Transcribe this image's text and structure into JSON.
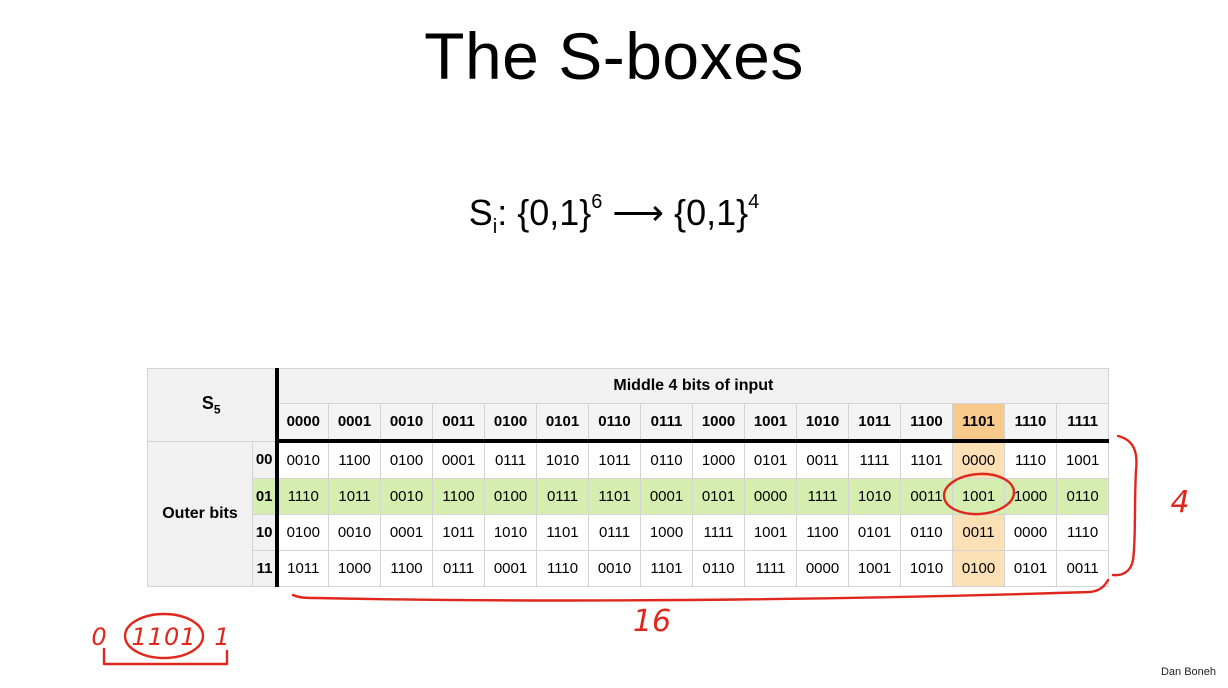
{
  "slide": {
    "title": "The S-boxes",
    "mapping": {
      "prefix": "S",
      "subscript": "i",
      "domain": ": {0,1}",
      "domain_exp": "6",
      "arrow": " ⟶ ",
      "codomain": "{0,1}",
      "codomain_exp": "4"
    },
    "credit": "Dan Boneh"
  },
  "table": {
    "name": "S",
    "name_sub": "5",
    "middle_header": "Middle 4 bits of input",
    "outer_header": "Outer bits",
    "columns": [
      "0000",
      "0001",
      "0010",
      "0011",
      "0100",
      "0101",
      "0110",
      "0111",
      "1000",
      "1001",
      "1010",
      "1011",
      "1100",
      "1101",
      "1110",
      "1111"
    ],
    "highlight_column": 13,
    "highlight_row": 1,
    "rows": [
      {
        "label": "00",
        "cells": [
          "0010",
          "1100",
          "0100",
          "0001",
          "0111",
          "1010",
          "1011",
          "0110",
          "1000",
          "0101",
          "0011",
          "1111",
          "1101",
          "0000",
          "1110",
          "1001"
        ]
      },
      {
        "label": "01",
        "cells": [
          "1110",
          "1011",
          "0010",
          "1100",
          "0100",
          "0111",
          "1101",
          "0001",
          "0101",
          "0000",
          "1111",
          "1010",
          "0011",
          "1001",
          "1000",
          "0110"
        ]
      },
      {
        "label": "10",
        "cells": [
          "0100",
          "0010",
          "0001",
          "1011",
          "1010",
          "1101",
          "0111",
          "1000",
          "1111",
          "1001",
          "1100",
          "0101",
          "0110",
          "0011",
          "0000",
          "1110"
        ]
      },
      {
        "label": "11",
        "cells": [
          "1011",
          "1000",
          "1100",
          "0111",
          "0001",
          "1110",
          "0010",
          "1101",
          "0110",
          "1111",
          "0000",
          "1001",
          "1010",
          "0100",
          "0101",
          "0011"
        ]
      }
    ]
  },
  "annotations": {
    "rows_count": "4",
    "cols_count": "16",
    "input_outer_left": "0",
    "input_middle": "1101",
    "input_outer_right": "1",
    "ink_color": "#e0271d"
  }
}
